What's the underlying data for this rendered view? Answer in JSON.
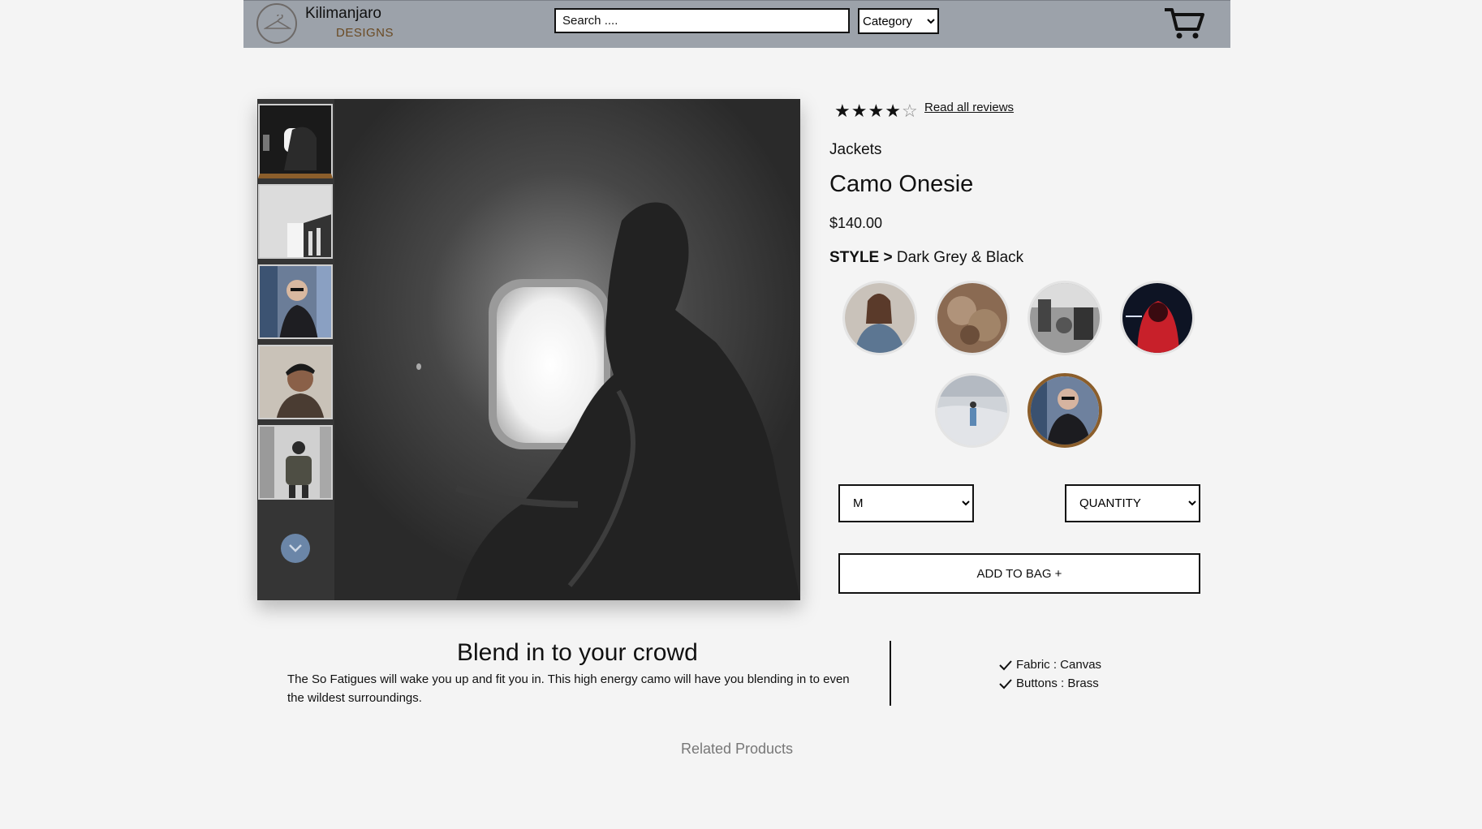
{
  "header": {
    "brand_name": "Kilimanjaro",
    "brand_sub": "DESIGNS",
    "search_placeholder": "Search ....",
    "category_selected": "Category",
    "logo_icon": "hanger-icon",
    "cart_icon": "cart-icon",
    "bg_color": "#9ca2aa"
  },
  "product": {
    "rating": 4,
    "rating_max": 5,
    "reviews_link": "Read all reviews",
    "category": "Jackets",
    "title": "Camo Onesie",
    "price": "$140.00",
    "style_label": "STYLE >",
    "style_value": "Dark Grey & Black",
    "swatches": [
      "portrait-denim-jacket",
      "warm-fur-texture",
      "street-scene-bw",
      "red-neon-hoodie",
      "snowy-hiker",
      "glasses-man-graffiti"
    ],
    "selected_swatch": 5,
    "size_selected": "M",
    "quantity_selected": "QUANTITY",
    "add_to_bag": "ADD TO BAG   +",
    "accent_color": "#8b5e2b"
  },
  "gallery": {
    "thumbnails": [
      "airplane-window-bw",
      "building-corner-bw",
      "glasses-man-graffiti",
      "cap-man-portrait",
      "backpack-walker"
    ],
    "active_thumbnail": 0,
    "scroll_icon": "chevron-down-icon"
  },
  "description": {
    "title": "Blend in to your crowd",
    "body": "The So Fatigues will wake you up and fit you in. This high energy camo will have you blending in to even the wildest surroundings.",
    "features": [
      "Fabric : Canvas",
      "Buttons : Brass"
    ]
  },
  "related_title": "Related Products"
}
